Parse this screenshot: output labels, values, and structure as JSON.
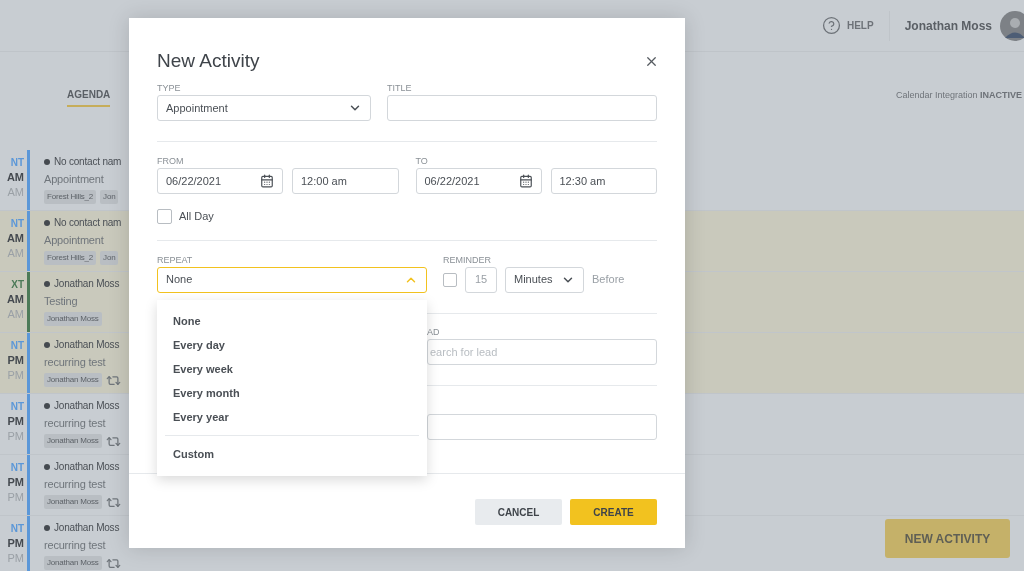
{
  "header": {
    "help": "HELP",
    "user": "Jonathan Moss"
  },
  "tabs": [
    {
      "label": "AGENDA",
      "selected": true
    }
  ],
  "calendar_integration": {
    "label": "Calendar Integration",
    "status": "INACTIVE"
  },
  "agenda": [
    {
      "type_label": "NT",
      "start": "AM",
      "end": "AM",
      "color": "#5b97d8",
      "highlighted": false,
      "name": "No contact nam",
      "subtitle": "Appointment",
      "tags": [
        "Forest Hills_2",
        "Jon"
      ],
      "recurring": false
    },
    {
      "type_label": "NT",
      "start": "AM",
      "end": "AM",
      "color": "#5b97d8",
      "highlighted": true,
      "name": "No contact nam",
      "subtitle": "Appointment",
      "tags": [
        "Forest Hills_2",
        "Jon"
      ],
      "recurring": false
    },
    {
      "type_label": "XT",
      "start": "AM",
      "end": "AM",
      "color": "#4c7a58",
      "highlighted": true,
      "name": "Jonathan Moss",
      "subtitle": "Testing",
      "tags": [
        "Jonathan Moss"
      ],
      "recurring": false
    },
    {
      "type_label": "NT",
      "start": "PM",
      "end": "PM",
      "color": "#5b97d8",
      "highlighted": true,
      "name": "Jonathan Moss",
      "subtitle": "recurring test",
      "tags": [
        "Jonathan Moss"
      ],
      "recurring": true
    },
    {
      "type_label": "NT",
      "start": "PM",
      "end": "PM",
      "color": "#5b97d8",
      "highlighted": false,
      "name": "Jonathan Moss",
      "subtitle": "recurring test",
      "tags": [
        "Jonathan Moss"
      ],
      "recurring": true
    },
    {
      "type_label": "NT",
      "start": "PM",
      "end": "PM",
      "color": "#5b97d8",
      "highlighted": false,
      "name": "Jonathan Moss",
      "subtitle": "recurring test",
      "tags": [
        "Jonathan Moss"
      ],
      "recurring": true
    },
    {
      "type_label": "NT",
      "start": "PM",
      "end": "PM",
      "color": "#5b97d8",
      "highlighted": false,
      "name": "Jonathan Moss",
      "subtitle": "recurring test",
      "tags": [
        "Jonathan Moss"
      ],
      "recurring": true
    }
  ],
  "new_activity_button": "NEW ACTIVITY",
  "modal": {
    "title": "New Activity",
    "type": {
      "label": "TYPE",
      "value": "Appointment"
    },
    "title_field": {
      "label": "TITLE"
    },
    "from": {
      "label": "FROM",
      "date": "06/22/2021",
      "time": "12:00 am"
    },
    "to": {
      "label": "TO",
      "date": "06/22/2021",
      "time": "12:30 am"
    },
    "all_day": {
      "label": "All Day",
      "checked": false
    },
    "repeat": {
      "label": "REPEAT",
      "value": "None",
      "expanded": true,
      "option_groups": [
        {
          "options": [
            {
              "label": "None",
              "selected": false
            },
            {
              "label": "Every day",
              "selected": false
            },
            {
              "label": "Every week",
              "selected": false
            },
            {
              "label": "Every month",
              "selected": false
            },
            {
              "label": "Every year",
              "selected": false
            }
          ]
        },
        {
          "options": [
            {
              "label": "Custom",
              "selected": false
            }
          ]
        }
      ]
    },
    "reminder": {
      "label": "REMINDER",
      "checked": false,
      "amount": "15",
      "disabled": true,
      "unit": "Minutes",
      "suffix": "Before"
    },
    "lead": {
      "label": "AD",
      "placeholder": "earch for lead"
    },
    "buttons": {
      "cancel": "CANCEL",
      "create": "CREATE"
    }
  }
}
